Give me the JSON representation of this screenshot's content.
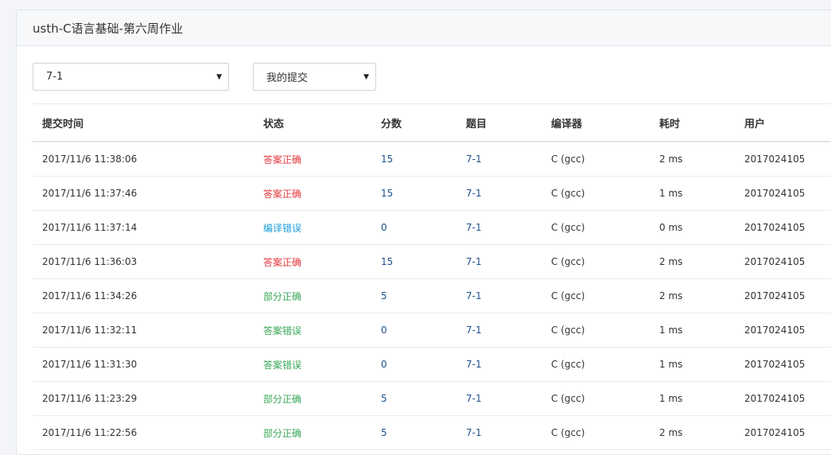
{
  "header": {
    "title": "usth-C语言基础-第六周作业"
  },
  "filters": {
    "problem": {
      "selected": "7-1"
    },
    "scope": {
      "selected": "我的提交"
    }
  },
  "colors": {
    "accepted": "#e4393c",
    "compile_error": "#1a9fd9",
    "partial": "#3aa757",
    "wrong": "#3aa757",
    "link": "#1d4f8b"
  },
  "table": {
    "columns": [
      "提交时间",
      "状态",
      "分数",
      "题目",
      "编译器",
      "耗时",
      "用户"
    ],
    "rows": [
      {
        "time": "2017/11/6 11:38:06",
        "status": "答案正确",
        "status_type": "accepted",
        "score": "15",
        "problem": "7-1",
        "compiler": "C (gcc)",
        "cost": "2 ms",
        "user": "2017024105"
      },
      {
        "time": "2017/11/6 11:37:46",
        "status": "答案正确",
        "status_type": "accepted",
        "score": "15",
        "problem": "7-1",
        "compiler": "C (gcc)",
        "cost": "1 ms",
        "user": "2017024105"
      },
      {
        "time": "2017/11/6 11:37:14",
        "status": "编译错误",
        "status_type": "compile",
        "score": "0",
        "problem": "7-1",
        "compiler": "C (gcc)",
        "cost": "0 ms",
        "user": "2017024105"
      },
      {
        "time": "2017/11/6 11:36:03",
        "status": "答案正确",
        "status_type": "accepted",
        "score": "15",
        "problem": "7-1",
        "compiler": "C (gcc)",
        "cost": "2 ms",
        "user": "2017024105"
      },
      {
        "time": "2017/11/6 11:34:26",
        "status": "部分正确",
        "status_type": "partial",
        "score": "5",
        "problem": "7-1",
        "compiler": "C (gcc)",
        "cost": "2 ms",
        "user": "2017024105"
      },
      {
        "time": "2017/11/6 11:32:11",
        "status": "答案错误",
        "status_type": "wrong",
        "score": "0",
        "problem": "7-1",
        "compiler": "C (gcc)",
        "cost": "1 ms",
        "user": "2017024105"
      },
      {
        "time": "2017/11/6 11:31:30",
        "status": "答案错误",
        "status_type": "wrong",
        "score": "0",
        "problem": "7-1",
        "compiler": "C (gcc)",
        "cost": "1 ms",
        "user": "2017024105"
      },
      {
        "time": "2017/11/6 11:23:29",
        "status": "部分正确",
        "status_type": "partial",
        "score": "5",
        "problem": "7-1",
        "compiler": "C (gcc)",
        "cost": "1 ms",
        "user": "2017024105"
      },
      {
        "time": "2017/11/6 11:22:56",
        "status": "部分正确",
        "status_type": "partial",
        "score": "5",
        "problem": "7-1",
        "compiler": "C (gcc)",
        "cost": "2 ms",
        "user": "2017024105"
      }
    ]
  }
}
